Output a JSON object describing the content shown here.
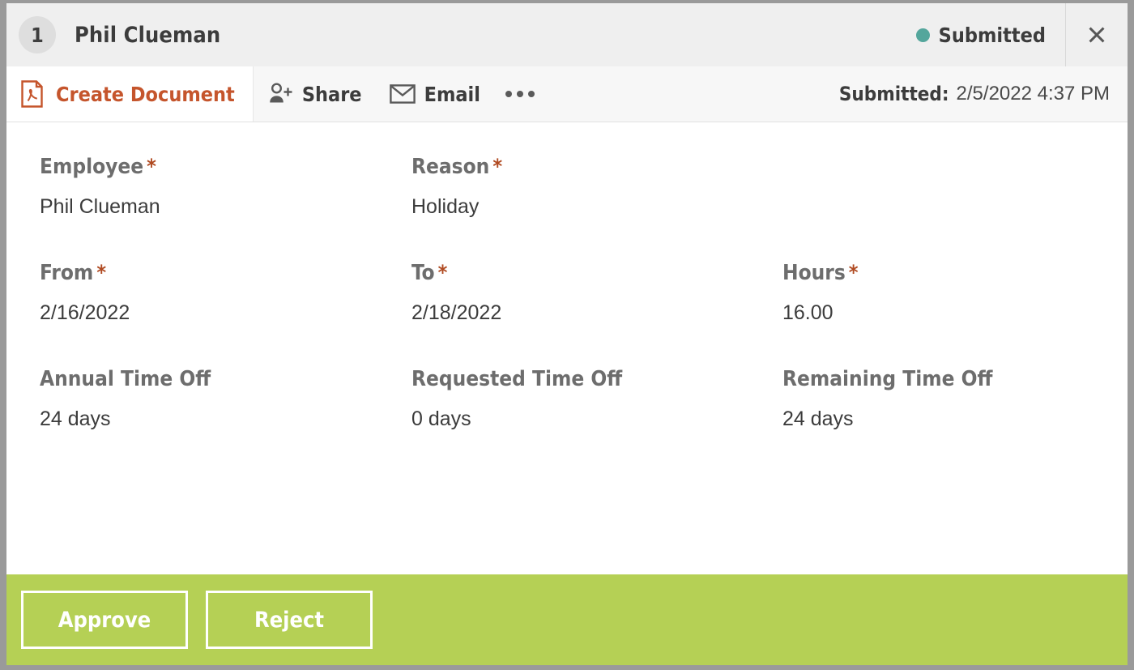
{
  "window": {
    "record_number": "1",
    "record_title": "Phil Clueman",
    "status": "Submitted",
    "status_dot_color": "#54a69c",
    "close_icon": "close-icon"
  },
  "toolbar": {
    "items": [
      {
        "label": "Create Document",
        "icon": "pdf-document-icon",
        "active": true
      },
      {
        "label": "Share",
        "icon": "person-add-icon",
        "active": false
      },
      {
        "label": "Email",
        "icon": "envelope-icon",
        "active": false
      }
    ],
    "overflow_icon": "ellipsis-icon",
    "stamp_key": "Submitted:",
    "stamp_value": "2/5/2022 4:37 PM",
    "accent_color": "#c5552c"
  },
  "form": {
    "rows": [
      {
        "fields": [
          {
            "label": "Employee",
            "required": true,
            "value": "Phil Clueman"
          },
          {
            "label": "Reason",
            "required": true,
            "value": "Holiday"
          }
        ]
      },
      {
        "fields": [
          {
            "label": "From",
            "required": true,
            "value": "2/16/2022"
          },
          {
            "label": "To",
            "required": true,
            "value": "2/18/2022"
          },
          {
            "label": "Hours",
            "required": true,
            "value": "16.00"
          }
        ]
      },
      {
        "fields": [
          {
            "label": "Annual Time Off",
            "required": false,
            "value": "24 days"
          },
          {
            "label": "Requested Time Off",
            "required": false,
            "value": "0 days"
          },
          {
            "label": "Remaining Time Off",
            "required": false,
            "value": "24 days"
          }
        ]
      }
    ],
    "required_marker": "*"
  },
  "actions": {
    "bar_color": "#b5d055",
    "buttons": [
      {
        "label": "Approve",
        "name": "approve-button"
      },
      {
        "label": "Reject",
        "name": "reject-button"
      }
    ]
  }
}
